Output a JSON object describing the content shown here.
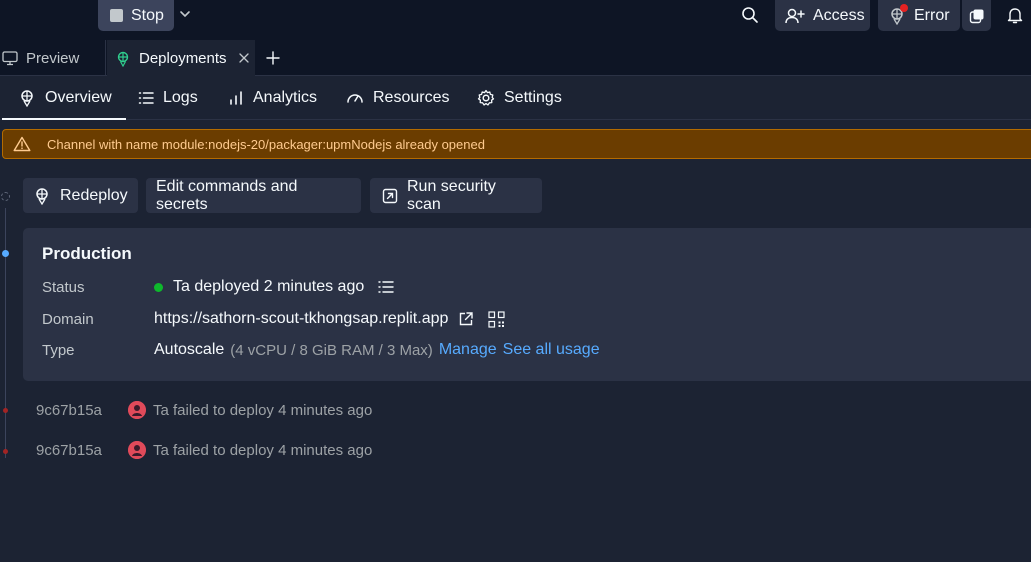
{
  "topbar": {
    "stop_label": "Stop",
    "access_label": "Access",
    "error_label": "Error"
  },
  "tabs": [
    {
      "label": "Preview"
    },
    {
      "label": "Deployments"
    }
  ],
  "subnav": [
    {
      "label": "Overview"
    },
    {
      "label": "Logs"
    },
    {
      "label": "Analytics"
    },
    {
      "label": "Resources"
    },
    {
      "label": "Settings"
    }
  ],
  "warning": {
    "text": "Channel with name module:nodejs-20/packager:upmNodejs already opened"
  },
  "actions": {
    "redeploy": "Redeploy",
    "edit": "Edit commands and secrets",
    "scan": "Run security scan"
  },
  "production": {
    "title": "Production",
    "status_label": "Status",
    "status_value": "Ta deployed 2 minutes ago",
    "domain_label": "Domain",
    "domain_value": "https://sathorn-scout-tkhongsap.replit.app",
    "type_label": "Type",
    "type_value": "Autoscale",
    "type_detail": "(4 vCPU / 8 GiB RAM / 3 Max)",
    "manage_link": "Manage",
    "usage_link": "See all usage"
  },
  "history": [
    {
      "hash": "9c67b15a",
      "text": "Ta failed to deploy 4 minutes ago"
    },
    {
      "hash": "9c67b15a",
      "text": "Ta failed to deploy 4 minutes ago"
    }
  ],
  "colors": {
    "background": "#1c2333",
    "topbar": "#0e1525",
    "surface": "#2b3245",
    "link": "#57abff",
    "success": "#0eb82c",
    "warning_bg": "#6b3d00",
    "warning_text": "#ffcb8f"
  },
  "icons": [
    "stop-icon",
    "chevron-down-icon",
    "search-icon",
    "add-user-icon",
    "deploy-icon",
    "multiplayer-icon",
    "bell-icon",
    "monitor-icon",
    "close-icon",
    "plus-icon",
    "logs-icon",
    "analytics-icon",
    "gauge-icon",
    "gear-icon",
    "warning-icon",
    "external-link-icon",
    "qr-code-icon",
    "list-icon"
  ]
}
